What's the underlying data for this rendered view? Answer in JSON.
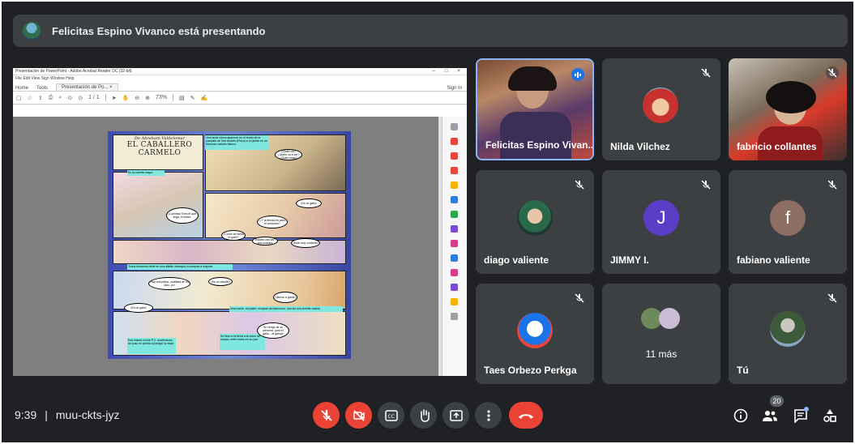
{
  "banner": {
    "text": "Felicitas Espino Vivanco está presentando"
  },
  "presentation": {
    "window_title": "Presentación de PowerPoint - Adobe Acrobat Reader DC (32-bit)",
    "menu": "File  Edit  View  Sign  Window  Help",
    "tabs": [
      "Home",
      "Tools",
      "Presentación de Po... ×"
    ],
    "sign_in": "Sign In",
    "page_indicator": "1 / 1",
    "zoom": "73%",
    "comic": {
      "author": "De Abraham Valdelomar",
      "title_line1": "EL CABALLERO",
      "title_line2": "CARMELO",
      "cap1": "Una tarde vimos aparecer en el fondo de la pampilla de San Andrés (Pisco) a un jinete en un hermoso caballo blanco.",
      "cap2": "En la carreta mayor",
      "cap3": "Todos tomamos bebé en una alfalfa, obsequio a comprar a mayorá",
      "cap4": "Una noche, mi padre, enojado del almuerzo, nos dio una terrible noticia.",
      "cap5": "Esa misma noche P.C. aviviéndose, se puso en piedra al pedigrí la mejor",
      "cap6": "Se llevo a la tierra a la unión de campo, entre todos en su paz",
      "b1": "¿Quién es? ¿Quién va a ser? ¿Quién llegó?",
      "b2": "¡Carmelo! Eres el que llega, el bravo.",
      "b3": "¡Roberto! ¡Bienvenido ya la calabaza me extrañaste!",
      "b4": "¡Es un gallo!",
      "b5": "¿Y la tienda es para el concurso?",
      "b6": "¿Cómo se llama el gallo?",
      "b7": "Estaba una vez una ocasión",
      "b8": "¡Está muy contento!",
      "b9": "Hay una pelea, ¡suéltala de mi lado, yo!",
      "b10": "¡Es un caballo!",
      "b11": "¡Vamos a ganar!",
      "b12": "¡Es un gallo!",
      "b13": "Se vengó de su persona, para el gallo... al galope"
    }
  },
  "participants": [
    {
      "name": "Felicitas Espino Vivan...",
      "speaking": true
    },
    {
      "name": "Nilda Vilchez",
      "muted": true
    },
    {
      "name": "fabricio collantes",
      "muted": true
    },
    {
      "name": "diago valiente",
      "muted": true
    },
    {
      "name": "JIMMY I.",
      "muted": true,
      "initial": "J",
      "color": "#5b3ec8"
    },
    {
      "name": "fabiano valiente",
      "muted": true,
      "initial": "f",
      "color": "#8d6e63"
    },
    {
      "name": "Taes Orbezo Perkga",
      "muted": true
    },
    {
      "name": "11 más"
    },
    {
      "name": "Tú",
      "muted": true
    }
  ],
  "bottom": {
    "time": "9:39",
    "separator": "|",
    "meeting_code": "muu-ckts-jyz",
    "participant_count": "20"
  },
  "colors": {
    "background": "#202124",
    "tile": "#3c4043",
    "red": "#ea4335",
    "active_border": "#8ab4f8"
  }
}
